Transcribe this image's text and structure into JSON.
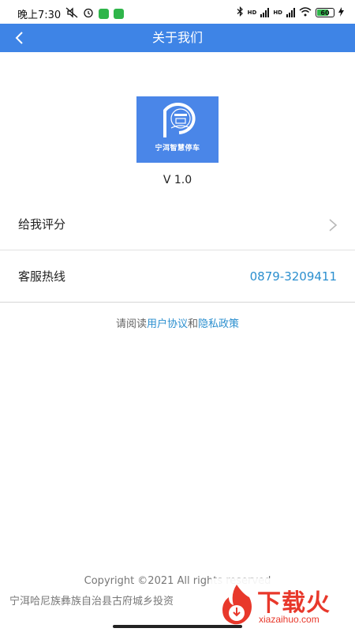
{
  "status_bar": {
    "time": "晚上7:30",
    "network_labels": [
      "HD",
      "HD"
    ],
    "battery_level": "60"
  },
  "nav": {
    "title": "关于我们"
  },
  "app": {
    "logo_text": "宁洱智慧停车",
    "version": "V 1.0"
  },
  "rows": {
    "rate_label": "给我评分",
    "hotline_label": "客服热线",
    "hotline_value": "0879-3209411"
  },
  "agreement": {
    "prefix": "请阅读",
    "user_agreement": "用户协议",
    "conjunction": "和",
    "privacy_policy": "隐私政策"
  },
  "footer": {
    "copyright": "Copyright ©2021 All rights reserved",
    "company": "宁洱哈尼族彝族自治县古府城乡投资"
  },
  "watermark": {
    "title": "下载火",
    "subtitle": "xiazaihuo.com"
  },
  "colors": {
    "nav_bg": "#3e84e6",
    "link": "#2b8fcf",
    "watermark": "#e8382b"
  }
}
